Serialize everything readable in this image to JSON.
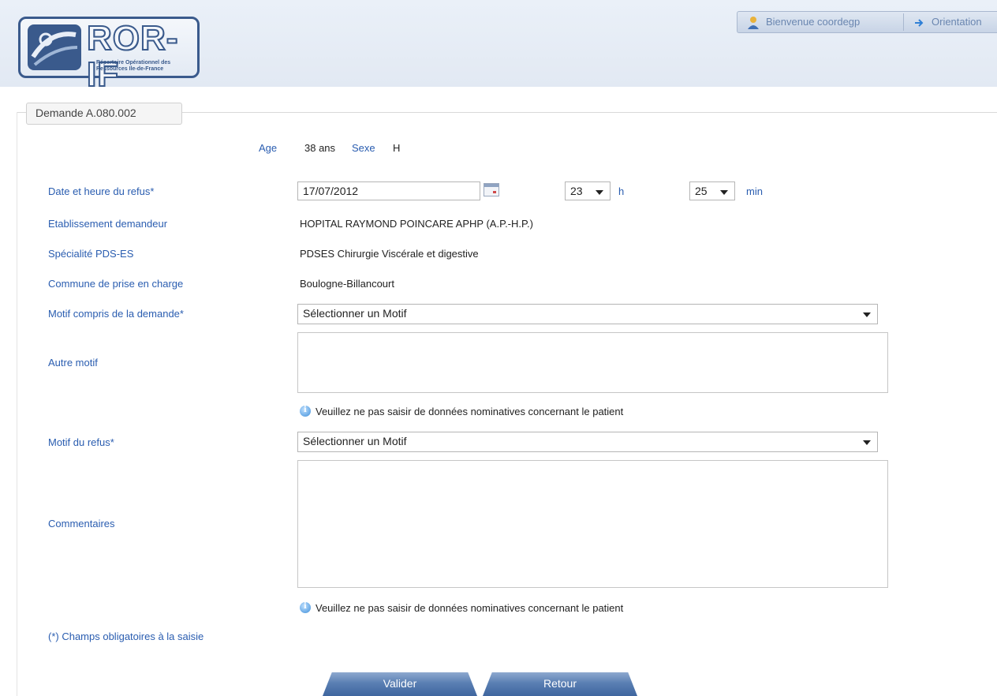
{
  "header": {
    "logo_text": "ROR-IF",
    "logo_subtitle": "Répertoire Opérationnel des Ressources Ile-de-France",
    "welcome": "Bienvenue coordegp",
    "nav_orientation": "Orientation"
  },
  "legend": "Demande A.080.002",
  "patient": {
    "age_label": "Age",
    "age_value": "38 ans",
    "sex_label": "Sexe",
    "sex_value": "H"
  },
  "form": {
    "date_label": "Date et heure du refus*",
    "date_value": "17/07/2012",
    "hour_value": "23",
    "hour_unit": "h",
    "minute_value": "25",
    "minute_unit": "min",
    "etab_label": "Etablissement demandeur",
    "etab_value": "HOPITAL RAYMOND POINCARE APHP (A.P.-H.P.)",
    "spec_label": "Spécialité PDS-ES",
    "spec_value": "PDSES Chirurgie Viscérale et digestive",
    "commune_label": "Commune de prise en charge",
    "commune_value": "Boulogne-Billancourt",
    "motif_compris_label": "Motif compris de la demande*",
    "motif_compris_value": "Sélectionner un Motif",
    "autre_motif_label": "Autre motif",
    "info_text_1": "Veuillez ne pas saisir de données nominatives concernant le patient",
    "motif_refus_label": "Motif du refus*",
    "motif_refus_value": "Sélectionner un Motif",
    "commentaires_label": "Commentaires",
    "info_text_2": "Veuillez ne pas saisir de données nominatives concernant le patient",
    "required_note": "(*) Champs obligatoires à la saisie"
  },
  "buttons": {
    "validate": "Valider",
    "back": "Retour"
  },
  "colors": {
    "label_blue": "#2a5db0",
    "button_blue": "#5a7fb3",
    "logo_blue": "#3a5a8c"
  }
}
